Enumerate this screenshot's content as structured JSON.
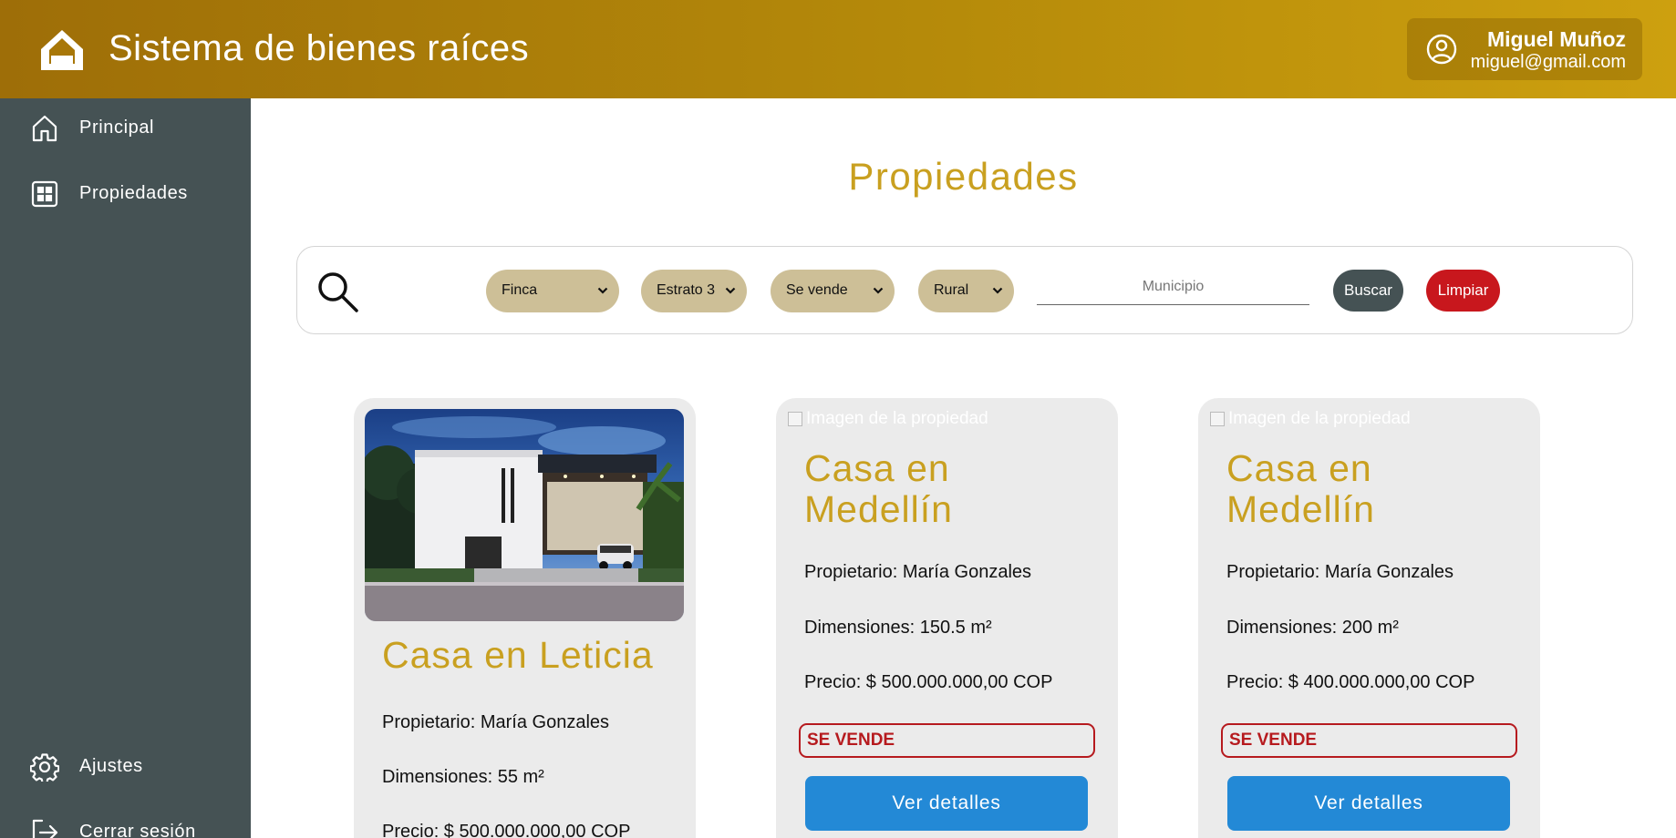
{
  "header": {
    "app_title": "Sistema de bienes raíces",
    "user_name": "Miguel Muñoz",
    "user_email": "miguel@gmail.com"
  },
  "sidebar": {
    "items": [
      {
        "label": "Principal",
        "icon": "home-icon"
      },
      {
        "label": "Propiedades",
        "icon": "grid-icon"
      },
      {
        "label": "Ajustes",
        "icon": "gear-icon"
      },
      {
        "label": "Cerrar sesión",
        "icon": "logout-icon"
      }
    ]
  },
  "main": {
    "page_title": "Propiedades",
    "filters": {
      "type": "Finca",
      "stratum": "Estrato 3",
      "operation": "Se vende",
      "zone": "Rural",
      "municipio_placeholder": "Municipio",
      "search_button": "Buscar",
      "clear_button": "Limpiar"
    },
    "cards": [
      {
        "title": "Casa en Leticia",
        "owner": "Propietario: María Gonzales",
        "dimensions": "Dimensiones: 55 m²",
        "price": "Precio: $ 500.000.000,00 COP",
        "image_alt": "Imagen de la propiedad"
      },
      {
        "title_line1": "Casa en",
        "title_line2": "Medellín",
        "owner": "Propietario: María Gonzales",
        "dimensions": "Dimensiones: 150.5 m²",
        "price": "Precio: $ 500.000.000,00 COP",
        "status": "SE VENDE",
        "button": "Ver detalles",
        "image_alt": "Imagen de la propiedad"
      },
      {
        "title_line1": "Casa en",
        "title_line2": "Medellín",
        "owner": "Propietario: María Gonzales",
        "dimensions": "Dimensiones: 200 m²",
        "price": "Precio: $ 400.000.000,00 COP",
        "status": "SE VENDE",
        "button": "Ver detalles",
        "image_alt": "Imagen de la propiedad"
      }
    ]
  },
  "colors": {
    "header_start": "#9e6e08",
    "header_end": "#cda00f",
    "sidebar": "#455254",
    "accent_gold": "#c9a020",
    "filter_chip": "#cdbf97",
    "danger": "#c8171d",
    "primary_button": "#2389d6",
    "card_bg": "#ebebeb"
  }
}
